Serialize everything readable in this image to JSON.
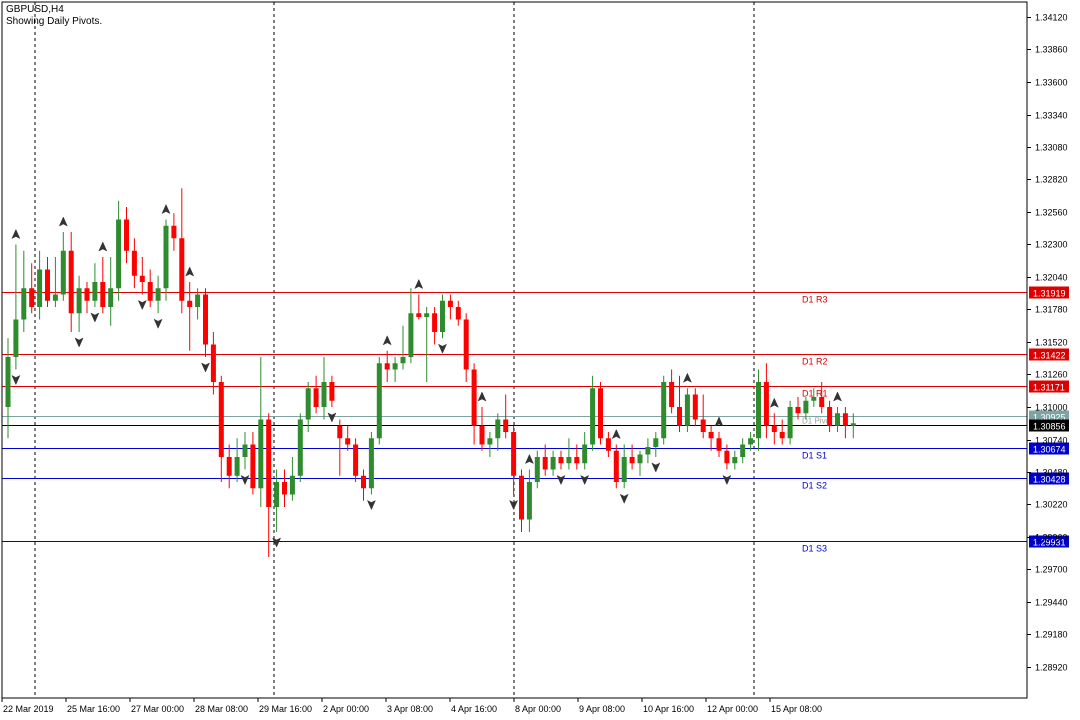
{
  "header": {
    "symbol_timeframe": "GBPUSD,H4",
    "indicator_caption": "Showing Daily Pivots."
  },
  "colors": {
    "background": "#ffffff",
    "bull_candle": "#2e8b2e",
    "bear_candle": "#ff0000",
    "resistance": "#dd0000",
    "support": "#0000cc",
    "pivot": "#7fa3a3",
    "current_price": "#000000",
    "text": "#000000"
  },
  "icons": {
    "fractal_up": "fractal-up-arrow-icon",
    "fractal_down": "fractal-down-arrow-icon"
  },
  "chart_data": {
    "type": "candlestick",
    "y_range": [
      1.2865,
      1.3425
    ],
    "y_ticks": [
      "1.34120",
      "1.33860",
      "1.33600",
      "1.33340",
      "1.33080",
      "1.32820",
      "1.32560",
      "1.32300",
      "1.32040",
      "1.31780",
      "1.31520",
      "1.31260",
      "1.31000",
      "1.30740",
      "1.30480",
      "1.30220",
      "1.29960",
      "1.29700",
      "1.29440",
      "1.29180",
      "1.28920"
    ],
    "x_labels": [
      "22 Mar 2019",
      "25 Mar 16:00",
      "27 Mar 00:00",
      "28 Mar 08:00",
      "29 Mar 16:00",
      "2 Apr 00:00",
      "3 Apr 08:00",
      "4 Apr 16:00",
      "8 Apr 00:00",
      "9 Apr 08:00",
      "10 Apr 16:00",
      "12 Apr 00:00",
      "15 Apr 08:00"
    ],
    "period_separators": [
      "25 Mar",
      "1 Apr",
      "8 Apr",
      "15 Apr"
    ],
    "pivot_levels": [
      {
        "name": "D1 R3",
        "price": "1.31919",
        "kind": "resistance"
      },
      {
        "name": "D1 R2",
        "price": "1.31422",
        "kind": "resistance"
      },
      {
        "name": "D1 R1",
        "price": "1.31171",
        "kind": "resistance"
      },
      {
        "name": "D1 Pivot",
        "price": "1.30925",
        "kind": "pivot"
      },
      {
        "name": "D1 S1",
        "price": "1.30674",
        "kind": "support"
      },
      {
        "name": "D1 S2",
        "price": "1.30428",
        "kind": "support"
      },
      {
        "name": "D1 S3",
        "price": "1.29931",
        "kind": "support"
      }
    ],
    "current_price": "1.30856",
    "candles": [
      {
        "o": 1.31,
        "h": 1.3155,
        "l": 1.3075,
        "c": 1.314
      },
      {
        "o": 1.314,
        "h": 1.323,
        "l": 1.313,
        "c": 1.317
      },
      {
        "o": 1.317,
        "h": 1.3225,
        "l": 1.316,
        "c": 1.3195
      },
      {
        "o": 1.3195,
        "h": 1.3215,
        "l": 1.3175,
        "c": 1.318
      },
      {
        "o": 1.318,
        "h": 1.3225,
        "l": 1.317,
        "c": 1.321
      },
      {
        "o": 1.321,
        "h": 1.322,
        "l": 1.318,
        "c": 1.3185
      },
      {
        "o": 1.3185,
        "h": 1.322,
        "l": 1.318,
        "c": 1.319
      },
      {
        "o": 1.319,
        "h": 1.324,
        "l": 1.3185,
        "c": 1.3225
      },
      {
        "o": 1.3225,
        "h": 1.324,
        "l": 1.316,
        "c": 1.3175
      },
      {
        "o": 1.3175,
        "h": 1.3205,
        "l": 1.316,
        "c": 1.3195
      },
      {
        "o": 1.3195,
        "h": 1.32,
        "l": 1.3175,
        "c": 1.3185
      },
      {
        "o": 1.3185,
        "h": 1.3215,
        "l": 1.318,
        "c": 1.32
      },
      {
        "o": 1.32,
        "h": 1.322,
        "l": 1.3175,
        "c": 1.318
      },
      {
        "o": 1.318,
        "h": 1.322,
        "l": 1.3165,
        "c": 1.3195
      },
      {
        "o": 1.3195,
        "h": 1.3265,
        "l": 1.3185,
        "c": 1.325
      },
      {
        "o": 1.325,
        "h": 1.326,
        "l": 1.3215,
        "c": 1.3225
      },
      {
        "o": 1.3225,
        "h": 1.3235,
        "l": 1.3195,
        "c": 1.3205
      },
      {
        "o": 1.3205,
        "h": 1.322,
        "l": 1.319,
        "c": 1.32
      },
      {
        "o": 1.32,
        "h": 1.321,
        "l": 1.318,
        "c": 1.3185
      },
      {
        "o": 1.3185,
        "h": 1.3205,
        "l": 1.3175,
        "c": 1.3195
      },
      {
        "o": 1.3195,
        "h": 1.325,
        "l": 1.3185,
        "c": 1.3245
      },
      {
        "o": 1.3245,
        "h": 1.3255,
        "l": 1.3225,
        "c": 1.3235
      },
      {
        "o": 1.3235,
        "h": 1.3275,
        "l": 1.3175,
        "c": 1.3185
      },
      {
        "o": 1.3185,
        "h": 1.32,
        "l": 1.3145,
        "c": 1.318
      },
      {
        "o": 1.318,
        "h": 1.3195,
        "l": 1.317,
        "c": 1.319
      },
      {
        "o": 1.319,
        "h": 1.3195,
        "l": 1.314,
        "c": 1.315
      },
      {
        "o": 1.315,
        "h": 1.316,
        "l": 1.311,
        "c": 1.312
      },
      {
        "o": 1.312,
        "h": 1.3125,
        "l": 1.304,
        "c": 1.306
      },
      {
        "o": 1.306,
        "h": 1.307,
        "l": 1.3035,
        "c": 1.3045
      },
      {
        "o": 1.3045,
        "h": 1.3075,
        "l": 1.304,
        "c": 1.306
      },
      {
        "o": 1.306,
        "h": 1.308,
        "l": 1.305,
        "c": 1.307
      },
      {
        "o": 1.307,
        "h": 1.308,
        "l": 1.303,
        "c": 1.3035
      },
      {
        "o": 1.3035,
        "h": 1.314,
        "l": 1.302,
        "c": 1.309
      },
      {
        "o": 1.309,
        "h": 1.3095,
        "l": 1.298,
        "c": 1.302
      },
      {
        "o": 1.302,
        "h": 1.305,
        "l": 1.3,
        "c": 1.304
      },
      {
        "o": 1.304,
        "h": 1.305,
        "l": 1.302,
        "c": 1.303
      },
      {
        "o": 1.303,
        "h": 1.306,
        "l": 1.3025,
        "c": 1.3045
      },
      {
        "o": 1.3045,
        "h": 1.3095,
        "l": 1.304,
        "c": 1.309
      },
      {
        "o": 1.309,
        "h": 1.312,
        "l": 1.308,
        "c": 1.3115
      },
      {
        "o": 1.3115,
        "h": 1.3125,
        "l": 1.3095,
        "c": 1.31
      },
      {
        "o": 1.31,
        "h": 1.314,
        "l": 1.309,
        "c": 1.312
      },
      {
        "o": 1.312,
        "h": 1.3125,
        "l": 1.31,
        "c": 1.3105
      },
      {
        "o": 1.3085,
        "h": 1.309,
        "l": 1.3045,
        "c": 1.3075
      },
      {
        "o": 1.3075,
        "h": 1.3085,
        "l": 1.3065,
        "c": 1.307
      },
      {
        "o": 1.307,
        "h": 1.3075,
        "l": 1.304,
        "c": 1.3045
      },
      {
        "o": 1.3045,
        "h": 1.305,
        "l": 1.3025,
        "c": 1.3035
      },
      {
        "o": 1.3035,
        "h": 1.308,
        "l": 1.303,
        "c": 1.3075
      },
      {
        "o": 1.3075,
        "h": 1.314,
        "l": 1.307,
        "c": 1.3135
      },
      {
        "o": 1.3135,
        "h": 1.3145,
        "l": 1.312,
        "c": 1.313
      },
      {
        "o": 1.313,
        "h": 1.314,
        "l": 1.312,
        "c": 1.3135
      },
      {
        "o": 1.3135,
        "h": 1.3165,
        "l": 1.313,
        "c": 1.314
      },
      {
        "o": 1.314,
        "h": 1.3195,
        "l": 1.3135,
        "c": 1.3175
      },
      {
        "o": 1.3175,
        "h": 1.319,
        "l": 1.317,
        "c": 1.3172
      },
      {
        "o": 1.3172,
        "h": 1.318,
        "l": 1.312,
        "c": 1.3175
      },
      {
        "o": 1.3175,
        "h": 1.318,
        "l": 1.315,
        "c": 1.316
      },
      {
        "o": 1.316,
        "h": 1.319,
        "l": 1.3155,
        "c": 1.3185
      },
      {
        "o": 1.3185,
        "h": 1.319,
        "l": 1.317,
        "c": 1.318
      },
      {
        "o": 1.318,
        "h": 1.3185,
        "l": 1.3165,
        "c": 1.317
      },
      {
        "o": 1.317,
        "h": 1.3175,
        "l": 1.312,
        "c": 1.313
      },
      {
        "o": 1.313,
        "h": 1.3135,
        "l": 1.307,
        "c": 1.3085
      },
      {
        "o": 1.3085,
        "h": 1.31,
        "l": 1.3065,
        "c": 1.307
      },
      {
        "o": 1.307,
        "h": 1.308,
        "l": 1.306,
        "c": 1.3075
      },
      {
        "o": 1.3075,
        "h": 1.3095,
        "l": 1.3065,
        "c": 1.309
      },
      {
        "o": 1.309,
        "h": 1.311,
        "l": 1.3075,
        "c": 1.308
      },
      {
        "o": 1.308,
        "h": 1.3085,
        "l": 1.303,
        "c": 1.3045
      },
      {
        "o": 1.3045,
        "h": 1.305,
        "l": 1.3,
        "c": 1.301
      },
      {
        "o": 1.301,
        "h": 1.305,
        "l": 1.3,
        "c": 1.304
      },
      {
        "o": 1.304,
        "h": 1.3065,
        "l": 1.3035,
        "c": 1.306
      },
      {
        "o": 1.306,
        "h": 1.307,
        "l": 1.3045,
        "c": 1.305
      },
      {
        "o": 1.305,
        "h": 1.3065,
        "l": 1.3045,
        "c": 1.306
      },
      {
        "o": 1.306,
        "h": 1.3065,
        "l": 1.305,
        "c": 1.3055
      },
      {
        "o": 1.3055,
        "h": 1.3075,
        "l": 1.305,
        "c": 1.306
      },
      {
        "o": 1.306,
        "h": 1.307,
        "l": 1.305,
        "c": 1.3055
      },
      {
        "o": 1.3055,
        "h": 1.308,
        "l": 1.305,
        "c": 1.307
      },
      {
        "o": 1.307,
        "h": 1.3125,
        "l": 1.3065,
        "c": 1.3115
      },
      {
        "o": 1.3115,
        "h": 1.312,
        "l": 1.307,
        "c": 1.3075
      },
      {
        "o": 1.3075,
        "h": 1.308,
        "l": 1.306,
        "c": 1.3065
      },
      {
        "o": 1.3065,
        "h": 1.307,
        "l": 1.3035,
        "c": 1.304
      },
      {
        "o": 1.304,
        "h": 1.307,
        "l": 1.3035,
        "c": 1.306
      },
      {
        "o": 1.306,
        "h": 1.307,
        "l": 1.305,
        "c": 1.3055
      },
      {
        "o": 1.3055,
        "h": 1.3065,
        "l": 1.3045,
        "c": 1.3062
      },
      {
        "o": 1.3062,
        "h": 1.3075,
        "l": 1.3055,
        "c": 1.3068
      },
      {
        "o": 1.3068,
        "h": 1.308,
        "l": 1.306,
        "c": 1.3075
      },
      {
        "o": 1.3075,
        "h": 1.3125,
        "l": 1.307,
        "c": 1.312
      },
      {
        "o": 1.312,
        "h": 1.313,
        "l": 1.3095,
        "c": 1.31
      },
      {
        "o": 1.31,
        "h": 1.3125,
        "l": 1.308,
        "c": 1.3085
      },
      {
        "o": 1.3085,
        "h": 1.3115,
        "l": 1.308,
        "c": 1.311
      },
      {
        "o": 1.311,
        "h": 1.3115,
        "l": 1.3085,
        "c": 1.309
      },
      {
        "o": 1.309,
        "h": 1.311,
        "l": 1.3075,
        "c": 1.308
      },
      {
        "o": 1.308,
        "h": 1.3085,
        "l": 1.3065,
        "c": 1.3075
      },
      {
        "o": 1.3075,
        "h": 1.308,
        "l": 1.306,
        "c": 1.3065
      },
      {
        "o": 1.3065,
        "h": 1.307,
        "l": 1.305,
        "c": 1.3055
      },
      {
        "o": 1.3055,
        "h": 1.3065,
        "l": 1.305,
        "c": 1.306
      },
      {
        "o": 1.306,
        "h": 1.3075,
        "l": 1.3055,
        "c": 1.307
      },
      {
        "o": 1.307,
        "h": 1.308,
        "l": 1.3065,
        "c": 1.3075
      },
      {
        "o": 1.3075,
        "h": 1.313,
        "l": 1.3065,
        "c": 1.312
      },
      {
        "o": 1.312,
        "h": 1.3135,
        "l": 1.3075,
        "c": 1.3085
      },
      {
        "o": 1.3085,
        "h": 1.3095,
        "l": 1.307,
        "c": 1.308
      },
      {
        "o": 1.308,
        "h": 1.309,
        "l": 1.307,
        "c": 1.3075
      },
      {
        "o": 1.3075,
        "h": 1.3105,
        "l": 1.307,
        "c": 1.31
      },
      {
        "o": 1.31,
        "h": 1.3108,
        "l": 1.309,
        "c": 1.3095
      },
      {
        "o": 1.3095,
        "h": 1.3108,
        "l": 1.309,
        "c": 1.3105
      },
      {
        "o": 1.3105,
        "h": 1.3115,
        "l": 1.31,
        "c": 1.3108
      },
      {
        "o": 1.3108,
        "h": 1.312,
        "l": 1.3095,
        "c": 1.31
      },
      {
        "o": 1.31,
        "h": 1.3105,
        "l": 1.308,
        "c": 1.3085
      },
      {
        "o": 1.3085,
        "h": 1.31,
        "l": 1.308,
        "c": 1.3095
      },
      {
        "o": 1.3095,
        "h": 1.31,
        "l": 1.3075,
        "c": 1.3085
      },
      {
        "o": 1.3085,
        "h": 1.3095,
        "l": 1.3075,
        "c": 1.3087
      }
    ],
    "fractals_up": [
      1,
      7,
      12,
      20,
      23,
      48,
      52,
      60,
      66,
      77,
      86,
      90,
      97,
      105
    ],
    "fractals_down": [
      1,
      9,
      11,
      17,
      19,
      25,
      30,
      34,
      41,
      46,
      55,
      64,
      70,
      73,
      78,
      82,
      91
    ]
  }
}
